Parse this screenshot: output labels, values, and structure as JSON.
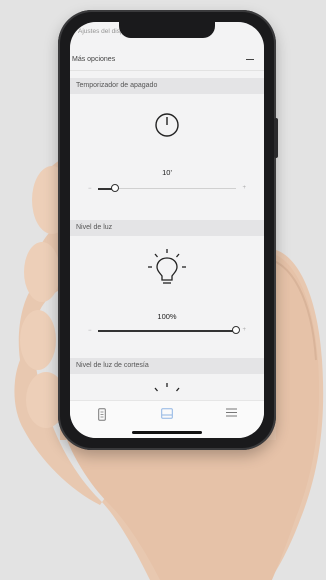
{
  "screen": {
    "cutoff_header": "Ajustes del dispositivo",
    "more_options": {
      "label": "Más opciones",
      "toggle_icon": "minus-icon"
    },
    "sections": [
      {
        "header": "Temporizador de apagado",
        "icon": "power-icon",
        "value": "10'",
        "slider_level": 0.12
      },
      {
        "header": "Nivel de luz",
        "icon": "lightbulb-icon",
        "value": "100%",
        "slider_level": 1.0
      },
      {
        "header": "Nivel de luz de cortesía",
        "icon": "lightbulb-icon"
      }
    ],
    "tabbar": {
      "tabs": [
        {
          "icon": "device-icon",
          "active": false
        },
        {
          "icon": "screen-icon",
          "active": true
        },
        {
          "icon": "menu-icon",
          "active": false
        }
      ]
    }
  },
  "colors": {
    "accent": "#8fb4e3",
    "background": "#e3e3e3",
    "section_header": "#e4e4e6"
  }
}
